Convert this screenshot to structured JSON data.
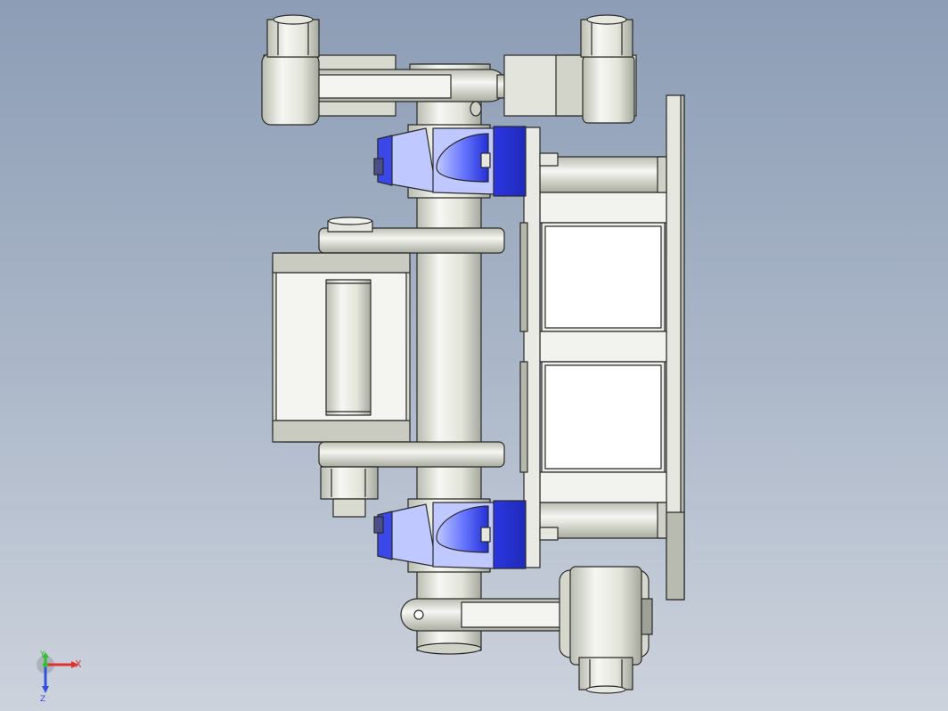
{
  "viewport": {
    "background": "gradient-blue-gray"
  },
  "model": {
    "metal_color": "#e6e8e0",
    "highlight_color": "#3340e0",
    "light_blue": "#bfc8ff",
    "edge_color": "#2a2a2a"
  },
  "triad": {
    "x_label": "X",
    "y_label": "Y",
    "z_label": "Z",
    "x_color": "#e03030",
    "y_color": "#30c030",
    "z_color": "#3050e0"
  }
}
